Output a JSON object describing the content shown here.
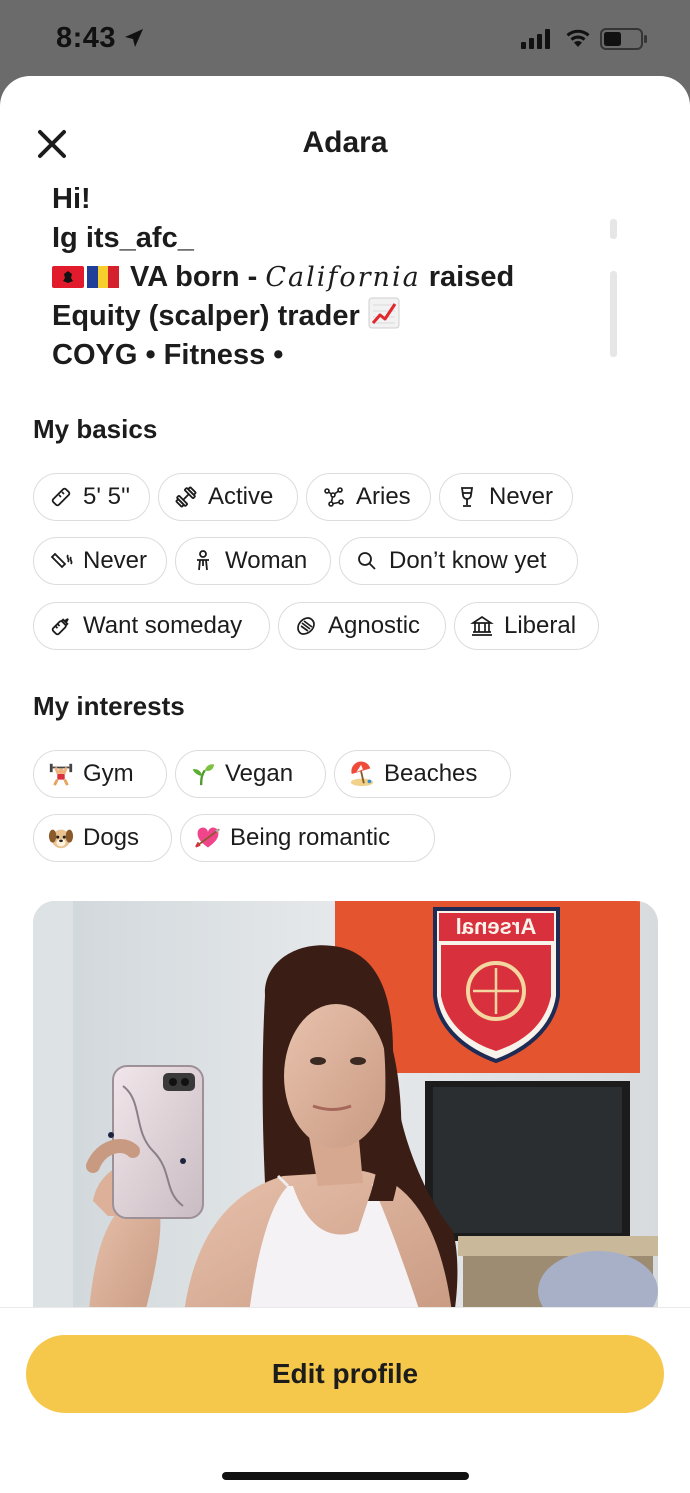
{
  "status_bar": {
    "time": "8:43"
  },
  "header": {
    "title": "Adara"
  },
  "bio": {
    "line1": "Hi!",
    "line2": "Ig its_afc_",
    "line3_mid": " VA born - ",
    "line3_script": "California",
    "line3_end": " raised",
    "line4": "Equity (scalper) trader ",
    "line5": " COYG • Fitness •"
  },
  "basics": {
    "title": "My basics",
    "chips": [
      {
        "label": "5' 5''",
        "icon": "ruler-icon"
      },
      {
        "label": "Active",
        "icon": "dumbbell-icon"
      },
      {
        "label": "Aries",
        "icon": "constellation-icon"
      },
      {
        "label": "Never",
        "icon": "wine-glass-icon"
      },
      {
        "label": "Never",
        "icon": "smoking-icon"
      },
      {
        "label": "Woman",
        "icon": "person-icon"
      },
      {
        "label": "Don’t know yet",
        "icon": "magnifier-icon"
      },
      {
        "label": "Want someday",
        "icon": "baby-bottle-icon"
      },
      {
        "label": "Agnostic",
        "icon": "praying-hands-icon"
      },
      {
        "label": "Liberal",
        "icon": "government-building-icon"
      }
    ]
  },
  "interests": {
    "title": "My interests",
    "chips": [
      {
        "label": "Gym",
        "icon": "weightlifter-emoji"
      },
      {
        "label": "Vegan",
        "icon": "seedling-emoji"
      },
      {
        "label": "Beaches",
        "icon": "beach-umbrella-emoji"
      },
      {
        "label": "Dogs",
        "icon": "dog-face-emoji"
      },
      {
        "label": "Being romantic",
        "icon": "heart-arrow-emoji"
      }
    ]
  },
  "photo": {
    "banner_text": "Arsenal"
  },
  "footer": {
    "edit_label": "Edit profile"
  },
  "colors": {
    "accent": "#f5c84c",
    "chip_border": "#dcdcdc",
    "text": "#1c1c1c"
  }
}
